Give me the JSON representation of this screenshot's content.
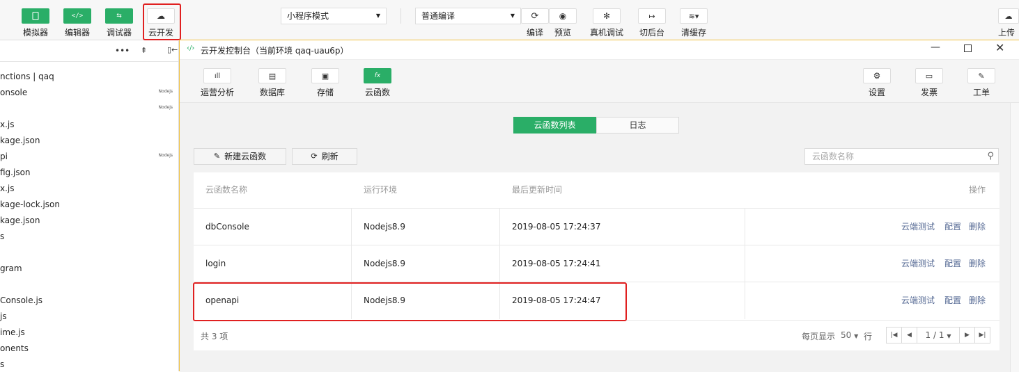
{
  "toolbar": {
    "simulator": "模拟器",
    "editor": "编辑器",
    "debugger": "调试器",
    "cloud": "云开发",
    "mode_select": "小程序模式",
    "compile_select": "普通编译",
    "compile": "编译",
    "preview": "预览",
    "remote_debug": "真机调试",
    "background": "切后台",
    "clear_cache": "清缓存",
    "upload": "上传"
  },
  "tree": {
    "items": [
      "nctions | qaq",
      "onsole",
      "x.js",
      "kage.json",
      "pi",
      "fig.json",
      "x.js",
      "kage-lock.json",
      "kage.json",
      "s",
      "gram",
      "Console.js",
      "js",
      "ime.js",
      "onents",
      "s"
    ],
    "badge": "Nodejs"
  },
  "dialog": {
    "title": "云开发控制台（当前环境 qaq-uau6p）",
    "tabs": [
      "运营分析",
      "数据库",
      "存储",
      "云函数"
    ],
    "right_tabs": [
      "设置",
      "发票",
      "工单"
    ],
    "segments": [
      "云函数列表",
      "日志"
    ],
    "new_button": "新建云函数",
    "refresh_button": "刷新",
    "search_placeholder": "云函数名称",
    "columns": [
      "云函数名称",
      "运行环境",
      "最后更新时间",
      "操作"
    ],
    "rows": [
      {
        "name": "dbConsole",
        "runtime": "Nodejs8.9",
        "updated": "2019-08-05 17:24:37"
      },
      {
        "name": "login",
        "runtime": "Nodejs8.9",
        "updated": "2019-08-05 17:24:41"
      },
      {
        "name": "openapi",
        "runtime": "Nodejs8.9",
        "updated": "2019-08-05 17:24:47"
      }
    ],
    "ops": [
      "云端测试",
      "配置",
      "删除"
    ],
    "total": "共 3 项",
    "per_page_label": "每页显示",
    "per_page": "50",
    "per_page_suffix": "行",
    "page": "1 / 1"
  }
}
